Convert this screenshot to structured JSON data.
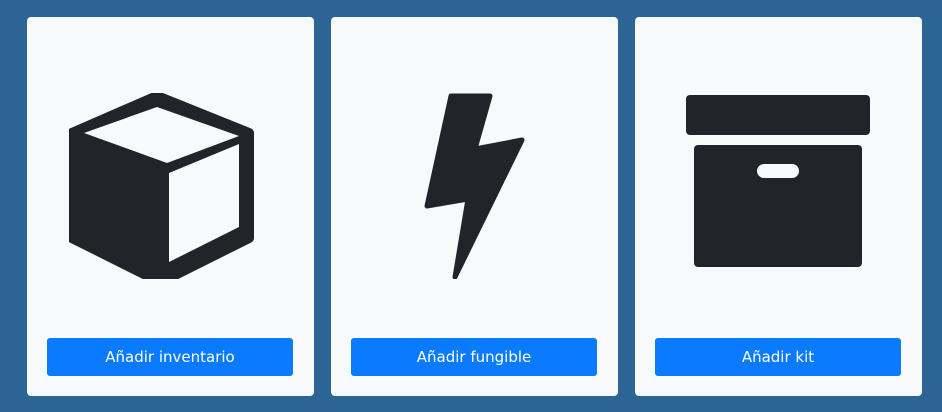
{
  "colors": {
    "page_background": "#2d6496",
    "card_background": "#f8f9fa",
    "icon_color": "#212529",
    "button_background": "#0a7bff",
    "button_text": "#ffffff"
  },
  "cards": [
    {
      "icon": "cube-box-icon",
      "button_label": "Añadir inventario"
    },
    {
      "icon": "lightning-bolt-icon",
      "button_label": "Añadir fungible"
    },
    {
      "icon": "archive-box-icon",
      "button_label": "Añadir kit"
    }
  ]
}
